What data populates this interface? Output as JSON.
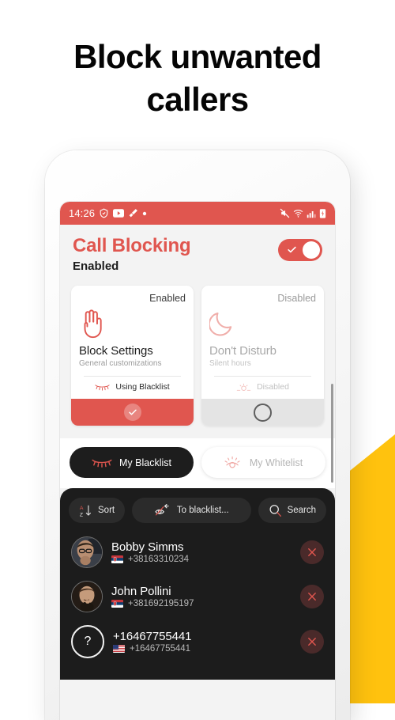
{
  "headline": {
    "line1": "Block unwanted",
    "line2": "callers"
  },
  "colors": {
    "accent_red": "#E0564F",
    "accent_yellow": "#FFC20E",
    "dark_panel": "#1C1C1C",
    "screen_bg": "#F3F3F3"
  },
  "status_bar": {
    "time": "14:26",
    "left_icons": [
      "shield-icon",
      "youtube-icon",
      "cleaner-icon",
      "dot-icon"
    ],
    "right_icons": [
      "mute-icon",
      "wifi-icon",
      "signal-icon",
      "battery-charging-icon"
    ]
  },
  "app_header": {
    "title": "Call Blocking",
    "subtitle": "Enabled",
    "toggle_state": "on",
    "toggle_icon": "check-icon"
  },
  "cards": [
    {
      "state_label": "Enabled",
      "icon": "stop-hand-icon",
      "title": "Block Settings",
      "subtitle": "General customizations",
      "note_icon": "closed-eye-icon",
      "note_label": "Using Blacklist",
      "footer_icon": "check-circle-icon",
      "enabled": true
    },
    {
      "state_label": "Disabled",
      "icon": "moon-icon",
      "title": "Don't Disturb",
      "subtitle": "Silent hours",
      "note_icon": "sunrise-icon",
      "note_label": "Disabled",
      "footer_icon": "empty-circle-icon",
      "enabled": false
    }
  ],
  "tabs": [
    {
      "label": "My Blacklist",
      "icon": "closed-eye-icon",
      "active": true
    },
    {
      "label": "My Whitelist",
      "icon": "open-eye-icon",
      "active": false
    }
  ],
  "actions": [
    {
      "label": "Sort",
      "icon": "sort-az-icon"
    },
    {
      "label": "To blacklist...",
      "icon": "crossed-eye-arrow-icon"
    },
    {
      "label": "Search",
      "icon": "search-icon"
    }
  ],
  "contacts": [
    {
      "name": "Bobby Simms",
      "number": "+38163310234",
      "flag": "rs",
      "avatar": "photo",
      "delete_icon": "close-icon"
    },
    {
      "name": "John Pollini",
      "number": "+381692195197",
      "flag": "rs",
      "avatar": "photo",
      "delete_icon": "close-icon"
    },
    {
      "name": "+16467755441",
      "number": "+16467755441",
      "flag": "us",
      "avatar": "unknown",
      "delete_icon": "close-icon"
    }
  ]
}
